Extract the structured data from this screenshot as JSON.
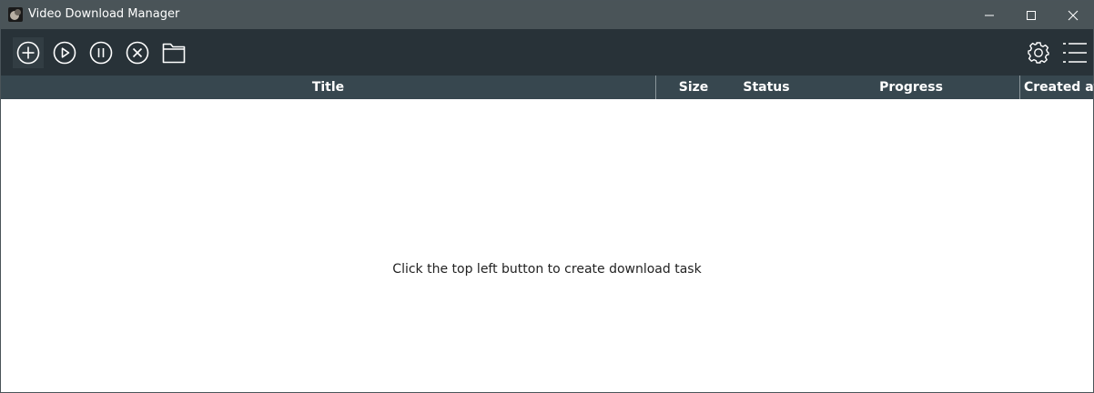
{
  "window": {
    "title": "Video Download Manager",
    "controls": [
      "minimize",
      "maximize",
      "close"
    ]
  },
  "toolbar": {
    "left_buttons": [
      {
        "name": "add-task",
        "icon": "plus-circle-icon"
      },
      {
        "name": "start",
        "icon": "play-circle-icon"
      },
      {
        "name": "pause",
        "icon": "pause-circle-icon"
      },
      {
        "name": "cancel",
        "icon": "x-circle-icon"
      },
      {
        "name": "open-folder",
        "icon": "folder-icon"
      }
    ],
    "right_buttons": [
      {
        "name": "settings",
        "icon": "gear-icon"
      },
      {
        "name": "menu",
        "icon": "list-menu-icon"
      }
    ]
  },
  "table": {
    "columns": [
      "Title",
      "Size",
      "Status",
      "Progress",
      "Created at"
    ],
    "rows": []
  },
  "empty_message": "Click the top left button to create download task",
  "colors": {
    "titlebar": "#4a5458",
    "toolbar": "#283238",
    "header": "#37474f",
    "content": "#ffffff"
  }
}
